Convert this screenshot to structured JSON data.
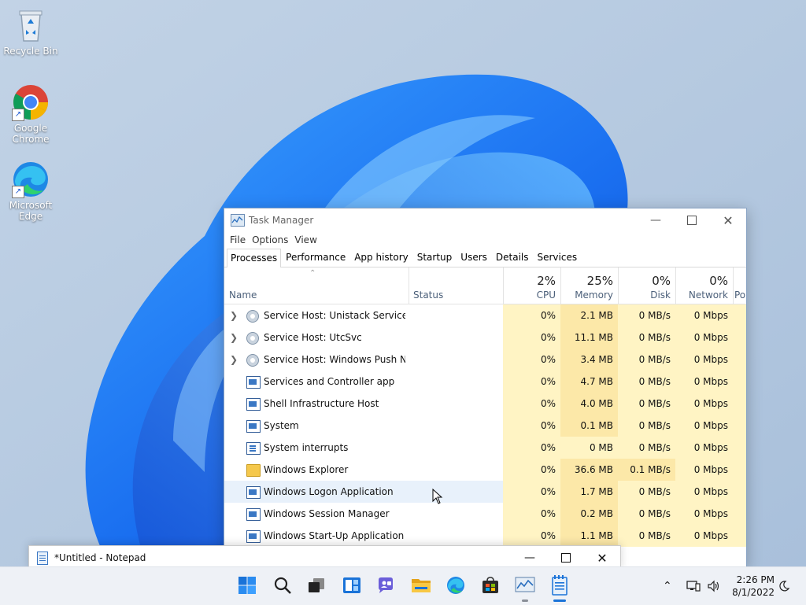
{
  "desktop": {
    "icons": [
      {
        "label": "Recycle Bin",
        "icon": "recycle-bin-icon"
      },
      {
        "label": "Google Chrome",
        "icon": "chrome-icon"
      },
      {
        "label": "Microsoft Edge",
        "icon": "edge-icon"
      }
    ]
  },
  "task_manager": {
    "title": "Task Manager",
    "menu": [
      "File",
      "Options",
      "View"
    ],
    "tabs": [
      "Processes",
      "Performance",
      "App history",
      "Startup",
      "Users",
      "Details",
      "Services"
    ],
    "active_tab": "Processes",
    "columns": {
      "name": "Name",
      "status": "Status",
      "cpu": {
        "percent": "2%",
        "label": "CPU"
      },
      "memory": {
        "percent": "25%",
        "label": "Memory"
      },
      "disk": {
        "percent": "0%",
        "label": "Disk"
      },
      "network": {
        "percent": "0%",
        "label": "Network"
      },
      "power": {
        "label": "Po"
      }
    },
    "rows": [
      {
        "name": "Service Host: Unistack Service G...",
        "expandable": true,
        "icon": "gear-icon",
        "cpu": "0%",
        "memory": "2.1 MB",
        "disk": "0 MB/s",
        "network": "0 Mbps"
      },
      {
        "name": "Service Host: UtcSvc",
        "expandable": true,
        "icon": "gear-icon",
        "cpu": "0%",
        "memory": "11.1 MB",
        "disk": "0 MB/s",
        "network": "0 Mbps"
      },
      {
        "name": "Service Host: Windows Push No...",
        "expandable": true,
        "icon": "gear-icon",
        "cpu": "0%",
        "memory": "3.4 MB",
        "disk": "0 MB/s",
        "network": "0 Mbps"
      },
      {
        "name": "Services and Controller app",
        "expandable": false,
        "icon": "app-window-icon",
        "cpu": "0%",
        "memory": "4.7 MB",
        "disk": "0 MB/s",
        "network": "0 Mbps"
      },
      {
        "name": "Shell Infrastructure Host",
        "expandable": false,
        "icon": "app-window-icon",
        "cpu": "0%",
        "memory": "4.0 MB",
        "disk": "0 MB/s",
        "network": "0 Mbps"
      },
      {
        "name": "System",
        "expandable": false,
        "icon": "app-window-icon",
        "cpu": "0%",
        "memory": "0.1 MB",
        "disk": "0 MB/s",
        "network": "0 Mbps"
      },
      {
        "name": "System interrupts",
        "expandable": false,
        "icon": "list-window-icon",
        "cpu": "0%",
        "memory": "0 MB",
        "disk": "0 MB/s",
        "network": "0 Mbps"
      },
      {
        "name": "Windows Explorer",
        "expandable": false,
        "icon": "folder-icon",
        "cpu": "0%",
        "memory": "36.6 MB",
        "disk": "0.1 MB/s",
        "network": "0 Mbps"
      },
      {
        "name": "Windows Logon Application",
        "expandable": false,
        "icon": "app-window-icon",
        "cpu": "0%",
        "memory": "1.7 MB",
        "disk": "0 MB/s",
        "network": "0 Mbps"
      },
      {
        "name": "Windows Session Manager",
        "expandable": false,
        "icon": "app-window-icon",
        "cpu": "0%",
        "memory": "0.2 MB",
        "disk": "0 MB/s",
        "network": "0 Mbps"
      },
      {
        "name": "Windows Start-Up Application",
        "expandable": false,
        "icon": "app-window-icon",
        "cpu": "0%",
        "memory": "1.1 MB",
        "disk": "0 MB/s",
        "network": "0 Mbps"
      }
    ]
  },
  "notepad": {
    "title": "*Untitled - Notepad"
  },
  "taskbar": {
    "apps": [
      "start-icon",
      "search-icon",
      "task-view-icon",
      "widgets-icon",
      "chat-icon",
      "file-explorer-icon",
      "edge-icon",
      "store-icon",
      "task-manager-icon",
      "notepad-icon"
    ],
    "clock": {
      "time": "2:26 PM",
      "date": "8/1/2022"
    }
  }
}
